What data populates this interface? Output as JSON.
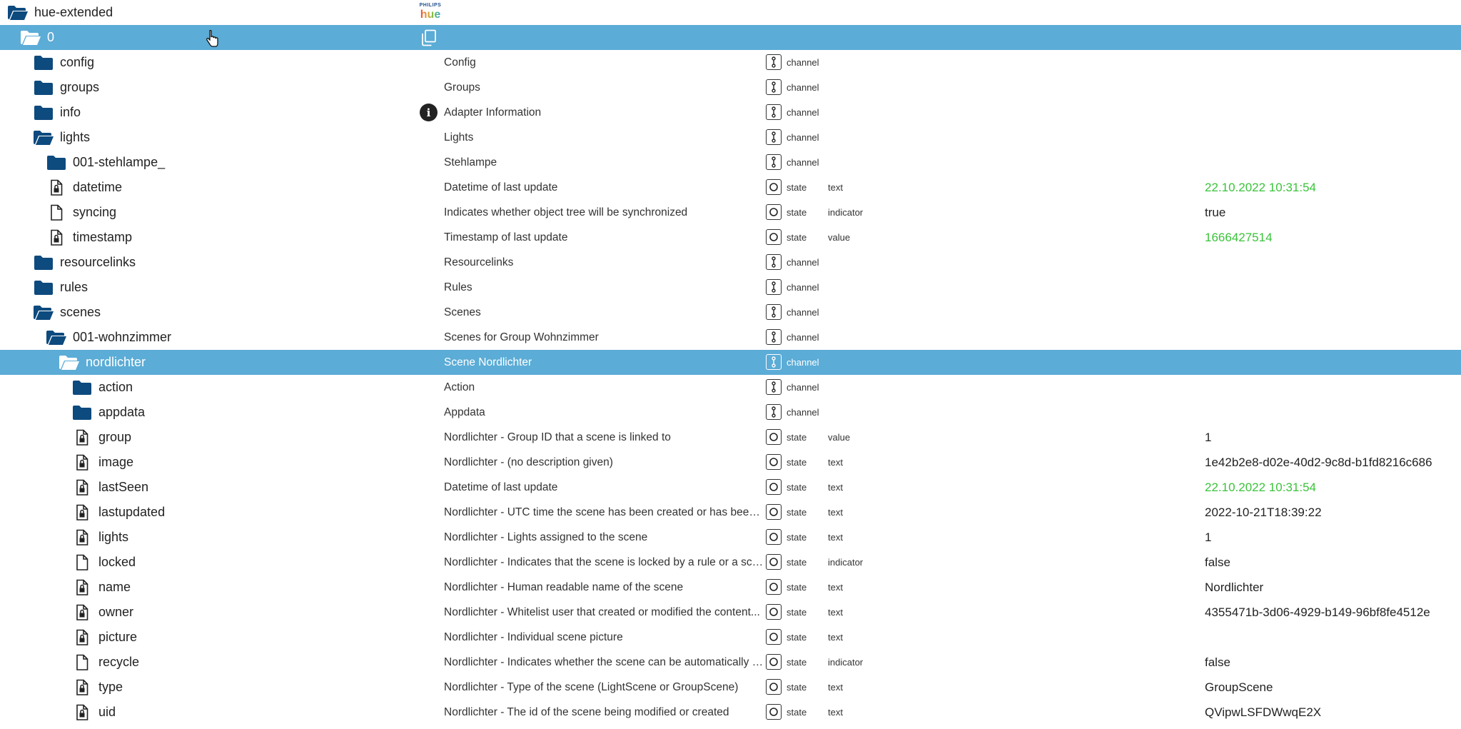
{
  "colors": {
    "selected_row": "#5bacd6",
    "folder": "#0d4a7e",
    "value_green": "#3ac33a"
  },
  "logo": {
    "brand": "PHILIPS",
    "product": "hue"
  },
  "rows": [
    {
      "name": "hue-extended",
      "indent": 10,
      "icon": "folder-open-icon",
      "logo": true
    },
    {
      "name": "0",
      "indent": 28,
      "icon": "folder-open-icon",
      "selected": true,
      "copy": true
    },
    {
      "name": "config",
      "indent": 46,
      "icon": "folder-icon",
      "desc": "Config",
      "role": "channel",
      "roleIcon": "channel-icon"
    },
    {
      "name": "groups",
      "indent": 46,
      "icon": "folder-icon",
      "desc": "Groups",
      "role": "channel",
      "roleIcon": "channel-icon"
    },
    {
      "name": "info",
      "indent": 46,
      "icon": "folder-icon",
      "desc": "Adapter Information",
      "role": "channel",
      "roleIcon": "channel-icon",
      "info": true
    },
    {
      "name": "lights",
      "indent": 46,
      "icon": "folder-open-icon",
      "desc": "Lights",
      "role": "channel",
      "roleIcon": "channel-icon"
    },
    {
      "name": "001-stehlampe_",
      "indent": 64,
      "icon": "folder-icon",
      "desc": "Stehlampe",
      "role": "channel",
      "roleIcon": "channel-icon"
    },
    {
      "name": "datetime",
      "indent": 64,
      "icon": "file-lock-icon",
      "desc": "Datetime of last update",
      "role": "state",
      "roleIcon": "state-icon",
      "type": "text",
      "value": "22.10.2022 10:31:54",
      "valueColor": "green"
    },
    {
      "name": "syncing",
      "indent": 64,
      "icon": "file-icon",
      "desc": "Indicates whether object tree will be synchronized",
      "role": "state",
      "roleIcon": "state-icon",
      "type": "indicator",
      "value": "true"
    },
    {
      "name": "timestamp",
      "indent": 64,
      "icon": "file-lock-icon",
      "desc": "Timestamp of last update",
      "role": "state",
      "roleIcon": "state-icon",
      "type": "value",
      "value": "1666427514",
      "valueColor": "green"
    },
    {
      "name": "resourcelinks",
      "indent": 46,
      "icon": "folder-icon",
      "desc": "Resourcelinks",
      "role": "channel",
      "roleIcon": "channel-icon"
    },
    {
      "name": "rules",
      "indent": 46,
      "icon": "folder-icon",
      "desc": "Rules",
      "role": "channel",
      "roleIcon": "channel-icon"
    },
    {
      "name": "scenes",
      "indent": 46,
      "icon": "folder-open-icon",
      "desc": "Scenes",
      "role": "channel",
      "roleIcon": "channel-icon"
    },
    {
      "name": "001-wohnzimmer",
      "indent": 64,
      "icon": "folder-open-icon",
      "desc": "Scenes for Group Wohnzimmer",
      "role": "channel",
      "roleIcon": "channel-icon"
    },
    {
      "name": "nordlichter",
      "indent": 82,
      "icon": "folder-open-icon",
      "desc": "Scene Nordlichter",
      "role": "channel",
      "roleIcon": "channel-icon",
      "selected": true
    },
    {
      "name": "action",
      "indent": 100,
      "icon": "folder-icon",
      "desc": "Action",
      "role": "channel",
      "roleIcon": "channel-icon"
    },
    {
      "name": "appdata",
      "indent": 100,
      "icon": "folder-icon",
      "desc": "Appdata",
      "role": "channel",
      "roleIcon": "channel-icon"
    },
    {
      "name": "group",
      "indent": 100,
      "icon": "file-lock-icon",
      "desc": "Nordlichter - Group ID that a scene is linked to",
      "role": "state",
      "roleIcon": "state-icon",
      "type": "value",
      "value": "1"
    },
    {
      "name": "image",
      "indent": 100,
      "icon": "file-lock-icon",
      "desc": "Nordlichter - (no description given)",
      "role": "state",
      "roleIcon": "state-icon",
      "type": "text",
      "value": "1e42b2e8-d02e-40d2-9c8d-b1fd8216c686"
    },
    {
      "name": "lastSeen",
      "indent": 100,
      "icon": "file-lock-icon",
      "desc": "Datetime of last update",
      "role": "state",
      "roleIcon": "state-icon",
      "type": "text",
      "value": "22.10.2022 10:31:54",
      "valueColor": "green"
    },
    {
      "name": "lastupdated",
      "indent": 100,
      "icon": "file-lock-icon",
      "desc": "Nordlichter - UTC time the scene has been created or has been ...",
      "role": "state",
      "roleIcon": "state-icon",
      "type": "text",
      "value": "2022-10-21T18:39:22"
    },
    {
      "name": "lights",
      "indent": 100,
      "icon": "file-lock-icon",
      "desc": "Nordlichter - Lights assigned to the scene",
      "role": "state",
      "roleIcon": "state-icon",
      "type": "text",
      "value": "1"
    },
    {
      "name": "locked",
      "indent": 100,
      "icon": "file-icon",
      "desc": "Nordlichter - Indicates that the scene is locked by a rule or a sch...",
      "role": "state",
      "roleIcon": "state-icon",
      "type": "indicator",
      "value": "false"
    },
    {
      "name": "name",
      "indent": 100,
      "icon": "file-lock-icon",
      "desc": "Nordlichter - Human readable name of the scene",
      "role": "state",
      "roleIcon": "state-icon",
      "type": "text",
      "value": "Nordlichter"
    },
    {
      "name": "owner",
      "indent": 100,
      "icon": "file-lock-icon",
      "desc": "Nordlichter - Whitelist user that created or modified the content...",
      "role": "state",
      "roleIcon": "state-icon",
      "type": "text",
      "value": "4355471b-3d06-4929-b149-96bf8fe4512e"
    },
    {
      "name": "picture",
      "indent": 100,
      "icon": "file-lock-icon",
      "desc": "Nordlichter - Individual scene picture",
      "role": "state",
      "roleIcon": "state-icon",
      "type": "text"
    },
    {
      "name": "recycle",
      "indent": 100,
      "icon": "file-icon",
      "desc": "Nordlichter - Indicates whether the scene can be automatically d...",
      "role": "state",
      "roleIcon": "state-icon",
      "type": "indicator",
      "value": "false"
    },
    {
      "name": "type",
      "indent": 100,
      "icon": "file-lock-icon",
      "desc": "Nordlichter - Type of the scene (LightScene or GroupScene)",
      "role": "state",
      "roleIcon": "state-icon",
      "type": "text",
      "value": "GroupScene"
    },
    {
      "name": "uid",
      "indent": 100,
      "icon": "file-lock-icon",
      "desc": "Nordlichter - The id of the scene being modified or created",
      "role": "state",
      "roleIcon": "state-icon",
      "type": "text",
      "value": "QVipwLSFDWwqE2X"
    }
  ]
}
